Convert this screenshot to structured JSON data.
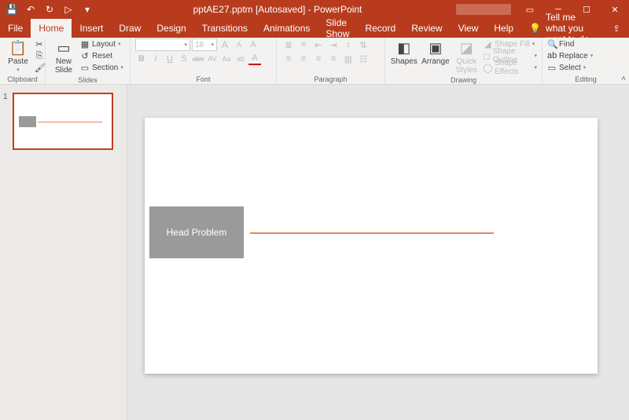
{
  "titlebar": {
    "title": "pptAE27.pptm [Autosaved] - PowerPoint"
  },
  "qat": {
    "save": "💾",
    "undo": "↶",
    "redo": "↻",
    "start": "▷",
    "more": "▾"
  },
  "window": {
    "ribbonopts": "▭",
    "min": "─",
    "max": "☐",
    "close": "✕"
  },
  "tabs": {
    "file": "File",
    "home": "Home",
    "insert": "Insert",
    "draw": "Draw",
    "design": "Design",
    "transitions": "Transitions",
    "animations": "Animations",
    "slideshow": "Slide Show",
    "record": "Record",
    "review": "Review",
    "view": "View",
    "help": "Help",
    "tellme": "Tell me what you want to do",
    "share": "⇪"
  },
  "ribbon": {
    "clipboard": {
      "label": "Clipboard",
      "paste": "Paste",
      "cut": "Cut",
      "copy": "Copy",
      "fmt": "Format Painter"
    },
    "slides": {
      "label": "Slides",
      "newslide": "New\nSlide",
      "layout": "Layout",
      "reset": "Reset",
      "section": "Section"
    },
    "font": {
      "label": "Font",
      "size": "18",
      "bold": "B",
      "italic": "I",
      "underline": "U",
      "shadow": "S",
      "strike": "abc",
      "spacing": "AV",
      "case": "Aa",
      "grow": "A",
      "shrink": "A",
      "clear": "A",
      "color": "A",
      "hilite": "ab"
    },
    "paragraph": {
      "label": "Paragraph"
    },
    "drawing": {
      "label": "Drawing",
      "shapes": "Shapes",
      "arrange": "Arrange",
      "quick": "Quick\nStyles",
      "fill": "Shape Fill",
      "outline": "Shape Outline",
      "effects": "Shape Effects"
    },
    "editing": {
      "label": "Editing",
      "find": "Find",
      "replace": "Replace",
      "select": "Select"
    }
  },
  "slide": {
    "number": "1",
    "title_text": "Head Problem"
  }
}
